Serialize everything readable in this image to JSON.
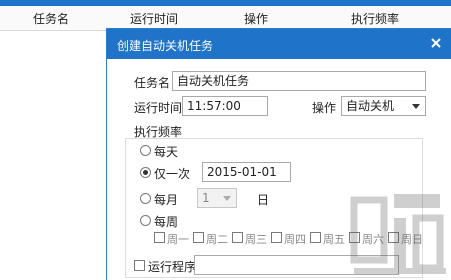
{
  "background_table": {
    "columns": [
      "任务名",
      "运行时间",
      "操作",
      "执行频率"
    ]
  },
  "dialog": {
    "title": "创建自动关机任务",
    "task_name_label": "任务名",
    "task_name_value": "自动关机任务",
    "run_time_label": "运行时间",
    "run_time_value": "11:57:00",
    "operation_label": "操作",
    "operation_value": "自动关机",
    "frequency_label": "执行频率",
    "options": {
      "daily": "每天",
      "once": "仅一次",
      "once_date": "2015-01-01",
      "monthly": "每月",
      "monthly_day": "1",
      "day_suffix": "日",
      "weekly": "每周"
    },
    "weekdays": [
      "周一",
      "周二",
      "周三",
      "周四",
      "周五",
      "周六",
      "周日"
    ],
    "selected_frequency": "once",
    "run_program_label": "运行程序",
    "run_program_value": ""
  },
  "colors": {
    "titlebar": "#1f73c9",
    "border": "#2a7dd1"
  },
  "icons": {
    "close": "close-icon",
    "dropdown": "chevron-down-icon"
  }
}
